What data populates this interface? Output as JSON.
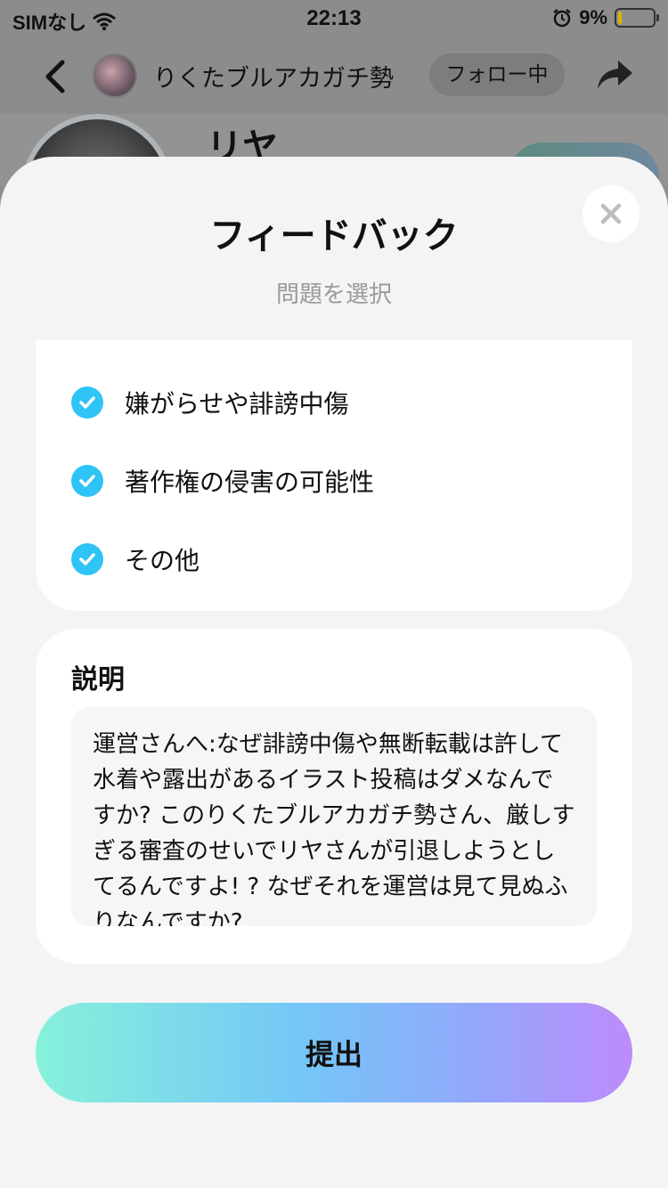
{
  "status_bar": {
    "carrier": "SIMなし",
    "time": "22:13",
    "battery": "9%",
    "battery_level": 0.09
  },
  "topnav": {
    "username": "りくたブルアカガチ勢",
    "follow_label": "フォロー中"
  },
  "profile": {
    "name": "リヤ"
  },
  "sheet": {
    "title": "フィードバック",
    "subtitle": "問題を選択",
    "options": [
      {
        "label": "嫌がらせや誹謗中傷",
        "checked": true
      },
      {
        "label": "著作権の侵害の可能性",
        "checked": true
      },
      {
        "label": "その他",
        "checked": true
      }
    ],
    "description_title": "説明",
    "description_text": "運営さんへ:なぜ誹謗中傷や無断転載は許して水着や露出があるイラスト投稿はダメなんですか? このりくたブルアカガチ勢さん、厳しすぎる審査のせいでリヤさんが引退しようとしてるんですよ! ? なぜそれを運営は見て見ぬふりなんですか?",
    "submit_label": "提出"
  },
  "colors": {
    "check": "#2ec4f5",
    "submit_gradient": [
      "#86f1da",
      "#74c6f8",
      "#95a6fb",
      "#bd8bfb"
    ]
  }
}
